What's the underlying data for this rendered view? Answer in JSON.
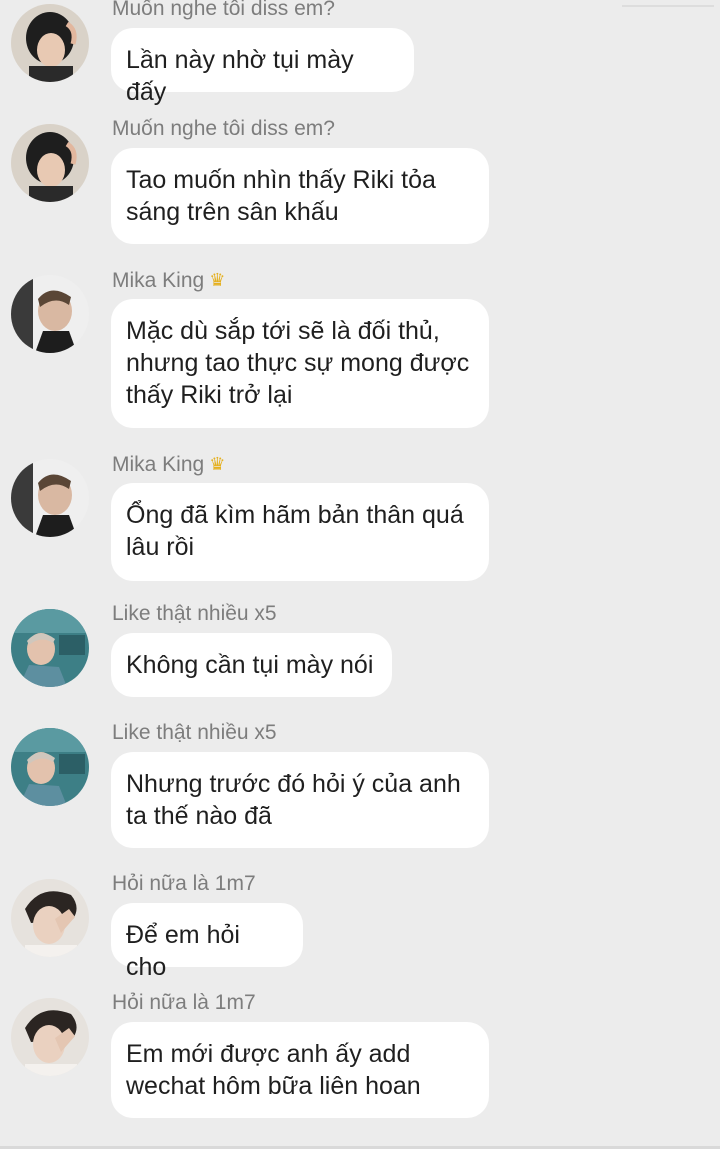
{
  "messages": [
    {
      "sender": "Muốn nghe tôi diss em?",
      "crown": false,
      "text": "Lần này nhờ tụi mày đấy",
      "avatar": "tall-hair"
    },
    {
      "sender": "Muốn nghe tôi diss em?",
      "crown": false,
      "text": "Tao muốn nhìn thấy Riki tỏa sáng trên sân khấu",
      "avatar": "tall-hair"
    },
    {
      "sender": "Mika King",
      "crown": true,
      "text": "Mặc dù sắp tới sẽ là đối thủ, nhưng tao thực sự mong được thấy Riki trở lại",
      "avatar": "profile"
    },
    {
      "sender": "Mika King",
      "crown": true,
      "text": "Ổng đã kìm hãm bản thân quá lâu rồi",
      "avatar": "profile"
    },
    {
      "sender": "Like thật nhiều x5",
      "crown": false,
      "text": "Không cần tụi mày nói",
      "avatar": "teal-room"
    },
    {
      "sender": "Like thật nhiều x5",
      "crown": false,
      "text": "Nhưng trước đó hỏi ý của anh ta thế nào đã",
      "avatar": "teal-room"
    },
    {
      "sender": "Hỏi nữa là 1m7",
      "crown": false,
      "text": "Để em hỏi cho",
      "avatar": "hand-face"
    },
    {
      "sender": "Hỏi nữa là 1m7",
      "crown": false,
      "text": "Em mới được anh ấy add wechat hôm bữa liên hoan",
      "avatar": "hand-face"
    }
  ],
  "colors": {
    "background": "#ececec",
    "bubble": "#ffffff",
    "sender_text": "#7d7d7d",
    "message_text": "#1f1f1f",
    "crown": "#e5b01e"
  },
  "icons": {
    "crown": "♛"
  }
}
